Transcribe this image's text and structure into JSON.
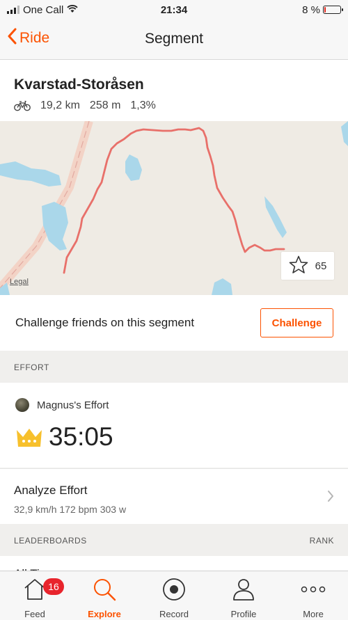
{
  "status": {
    "carrier": "One Call",
    "time": "21:34",
    "battery": "8 %",
    "battery_level": 0.08
  },
  "nav": {
    "back_label": "Ride",
    "title": "Segment"
  },
  "segment": {
    "name": "Kvarstad-Storåsen",
    "distance": "19,2 km",
    "elevation": "258 m",
    "grade": "1,3%"
  },
  "map": {
    "legal": "Legal",
    "star_count": "65",
    "route_color": "#e8706a",
    "water_color": "#aad7ea"
  },
  "challenge": {
    "text": "Challenge friends on this segment",
    "button": "Challenge"
  },
  "effort_section": {
    "label": "EFFORT"
  },
  "effort": {
    "athlete": "Magnus's Effort",
    "time": "35:05"
  },
  "analyze": {
    "title": "Analyze Effort",
    "stats": "32,9 km/h 172 bpm 303 w"
  },
  "leaderboards": {
    "label": "LEADERBOARDS",
    "rank_label": "RANK",
    "first_row": "All Ti"
  },
  "tabs": [
    {
      "label": "Feed",
      "icon": "home-icon",
      "badge": "16"
    },
    {
      "label": "Explore",
      "icon": "search-icon",
      "active": true
    },
    {
      "label": "Record",
      "icon": "record-icon"
    },
    {
      "label": "Profile",
      "icon": "profile-icon"
    },
    {
      "label": "More",
      "icon": "more-icon"
    }
  ],
  "colors": {
    "accent": "#fc5200",
    "badge": "#e8242c",
    "crown": "#f7c02c"
  }
}
